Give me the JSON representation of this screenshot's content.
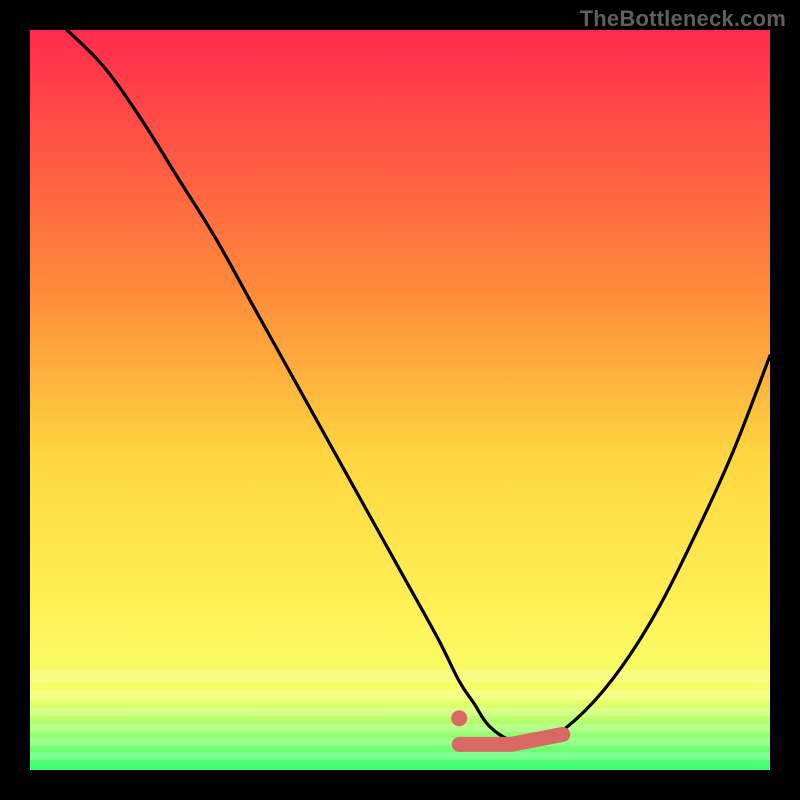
{
  "watermark": "TheBottleneck.com",
  "colors": {
    "bg": "#000000",
    "curve": "#000000",
    "marker": "#d86a63",
    "grad_top": "#ff2a4d",
    "grad_mid1": "#ff8a3a",
    "grad_mid2": "#ffd740",
    "grad_mid3": "#fff056",
    "grad_mid4": "#f5ff6a",
    "grad_bot": "#3bff79"
  },
  "chart_data": {
    "type": "line",
    "title": "",
    "xlabel": "",
    "ylabel": "",
    "xlim": [
      0,
      100
    ],
    "ylim": [
      0,
      100
    ],
    "series": [
      {
        "name": "curve",
        "x": [
          5,
          10,
          15,
          20,
          25,
          30,
          35,
          40,
          45,
          50,
          55,
          58,
          60,
          62,
          65,
          68,
          70,
          75,
          80,
          85,
          90,
          95,
          100
        ],
        "y": [
          100,
          95,
          88,
          80,
          72,
          63,
          54,
          45,
          36,
          27,
          18,
          12,
          9,
          6,
          4,
          4,
          4,
          8,
          14,
          22,
          32,
          43,
          56
        ]
      }
    ],
    "markers": {
      "name": "sweet-spot",
      "dot": {
        "x": 58,
        "y": 7
      },
      "bar": {
        "x0": 58,
        "x1": 72,
        "y": 4
      }
    },
    "annotations": []
  }
}
